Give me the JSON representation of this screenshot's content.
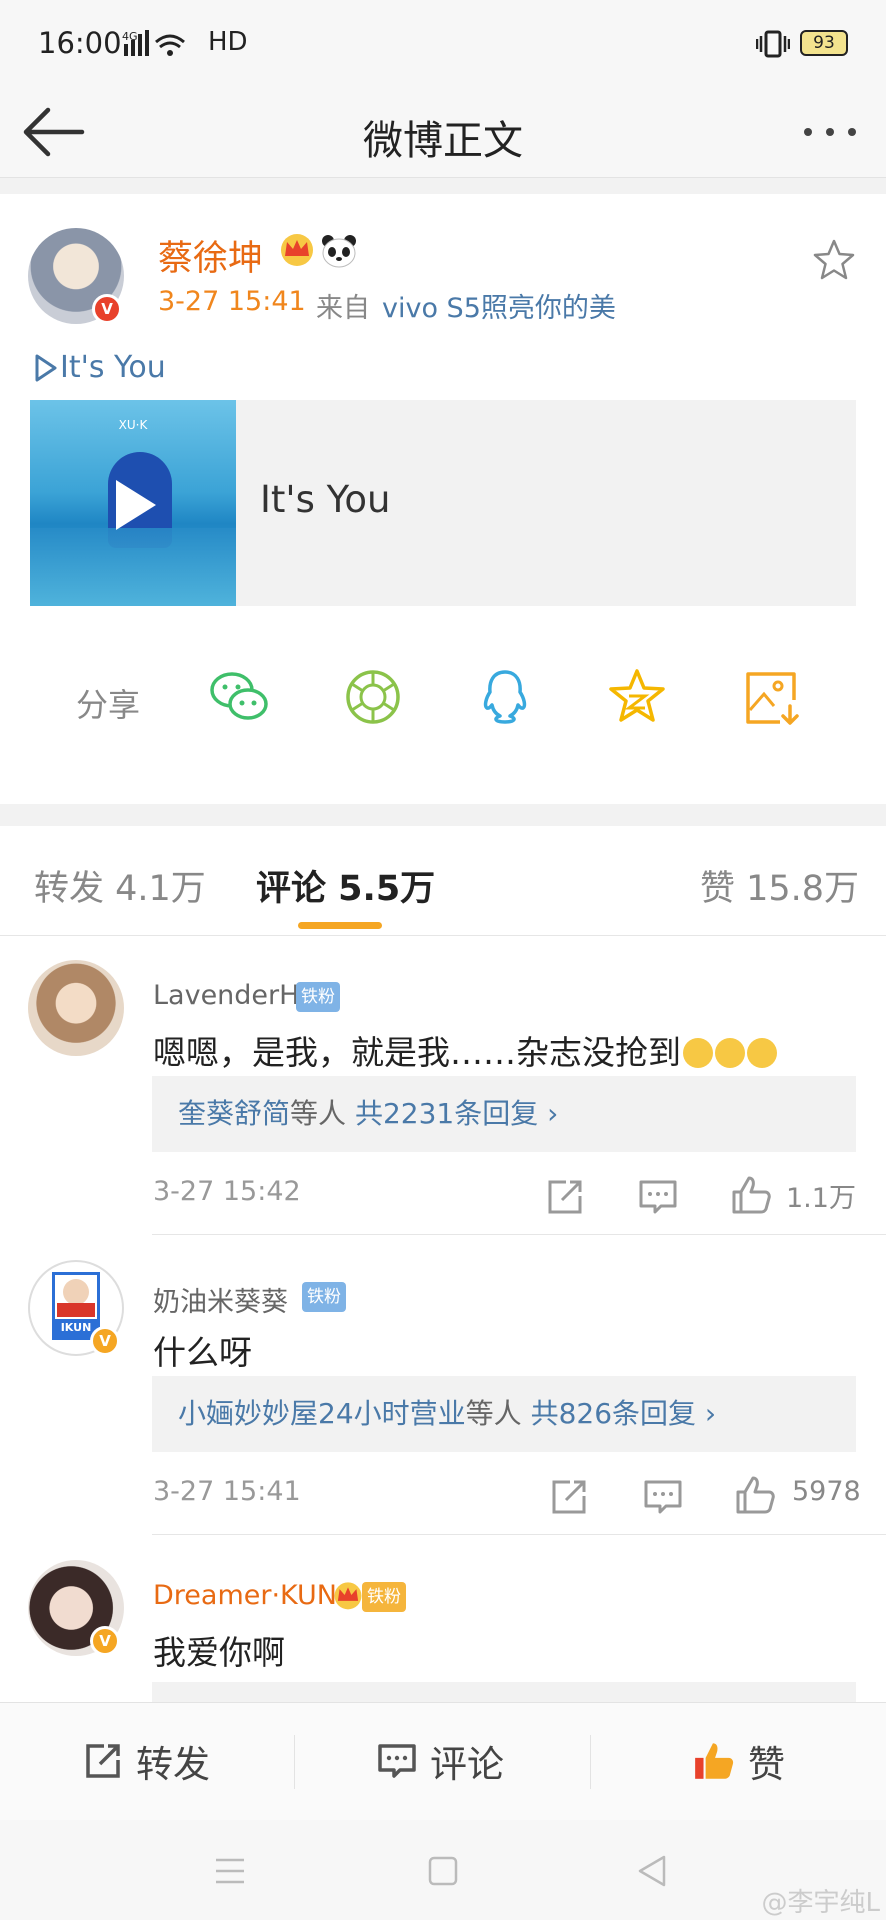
{
  "status_bar": {
    "time": "16:00",
    "network": "4G",
    "hd": "HD",
    "battery": "93"
  },
  "header": {
    "title": "微博正文"
  },
  "post": {
    "author": "蔡徐坤",
    "time": "3-27 15:41",
    "source_prefix": "来自",
    "source": "vivo S5照亮你的美",
    "music_link": "It's You",
    "music_title": "It's You",
    "cover_logo": "XU·K"
  },
  "share": {
    "label": "分享",
    "icons": [
      "wechat-icon",
      "moments-icon",
      "qq-icon",
      "qzone-icon",
      "save-image-icon"
    ]
  },
  "counts": {
    "repost": "转发 4.1万",
    "comments": "评论 5.5万",
    "likes": "赞 15.8万"
  },
  "comments": [
    {
      "name": "LavenderH",
      "badge": "铁粉",
      "text": "嗯嗯，是我，就是我……杂志没抢到",
      "reply_names": "奎葵舒简",
      "reply_mid": "等人",
      "reply_count": "共2231条回复 ›",
      "time": "3-27 15:42",
      "likes": "1.1万"
    },
    {
      "name": "奶油米葵葵",
      "badge": "铁粉",
      "text": "什么呀",
      "reply_names": "小婳妙妙屋24小时营业",
      "reply_mid": "等人",
      "reply_count": "共826条回复 ›",
      "time": "3-27 15:41",
      "likes": "5978",
      "avatar_text": "IKUN"
    },
    {
      "name": "Dreamer·KUN",
      "badge": "铁粉",
      "text": "我爱你啊"
    }
  ],
  "bottom_bar": {
    "repost": "转发",
    "comment": "评论",
    "like": "赞"
  },
  "watermark": "@李宇纯L",
  "colors": {
    "accent": "#f5a623",
    "name_orange": "#e86a13",
    "link_blue": "#4a79a8",
    "like_red": "#e8412b"
  }
}
